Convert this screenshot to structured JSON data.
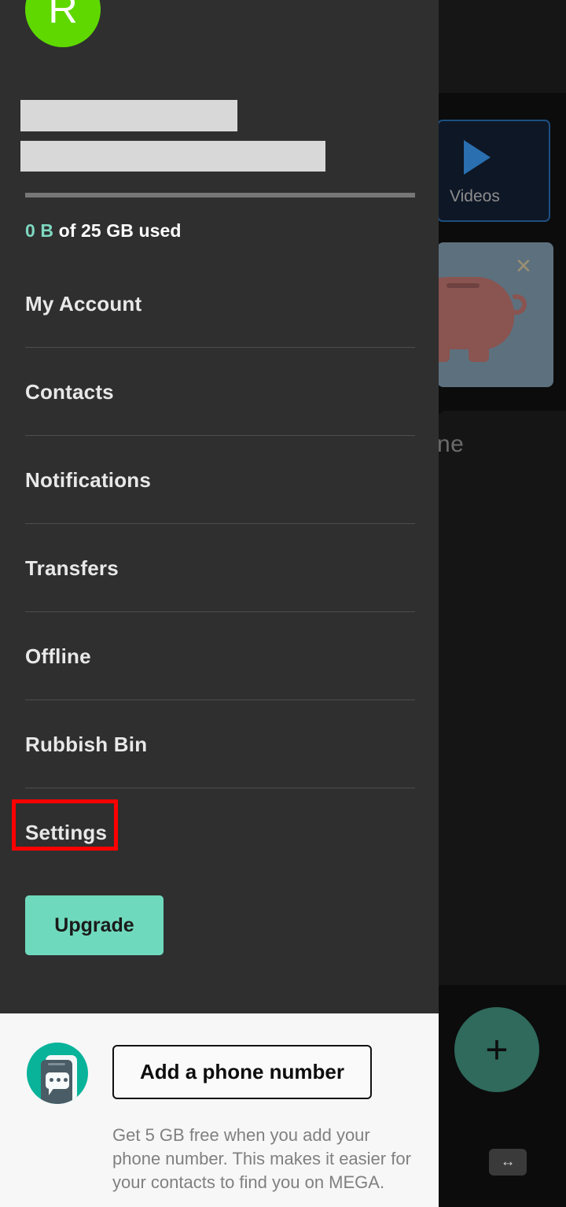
{
  "background_app": {
    "avatar": {
      "letter": "R",
      "status_dot": "online-dot"
    },
    "cards": [
      {
        "name": "videos-card",
        "label": "Videos",
        "icon": "play-icon",
        "border_color": "#1d4f80"
      },
      {
        "name": "piggy-bank-promo-card",
        "icon": "piggy-bank-icon",
        "close_icon": "×"
      }
    ],
    "sheet_title_partial": "ne",
    "fab": {
      "icon": "plus-icon",
      "label": "+",
      "color": "#2f6a5c"
    },
    "resize_handle": {
      "icon": "resize-horizontal-icon",
      "label": "↔"
    }
  },
  "drawer": {
    "avatar": {
      "letter": "R",
      "background_color": "#5fd800",
      "status_dot_color": "#9ce86a"
    },
    "redacted_fields": [
      {
        "name": "account-name-redacted"
      },
      {
        "name": "account-email-redacted"
      }
    ],
    "storage": {
      "used": "0 B",
      "rest": " of 25 GB used",
      "used_color": "#7fd8c0",
      "progress_percent": 0
    },
    "menu_items": [
      {
        "label": "My Account",
        "name": "sidebar-item-my-account"
      },
      {
        "label": "Contacts",
        "name": "sidebar-item-contacts"
      },
      {
        "label": "Notifications",
        "name": "sidebar-item-notifications"
      },
      {
        "label": "Transfers",
        "name": "sidebar-item-transfers"
      },
      {
        "label": "Offline",
        "name": "sidebar-item-offline"
      },
      {
        "label": "Rubbish Bin",
        "name": "sidebar-item-rubbish-bin"
      },
      {
        "label": "Settings",
        "name": "sidebar-item-settings",
        "highlighted": true
      }
    ],
    "upgrade_button": {
      "label": "Upgrade",
      "color": "#6fd9bd"
    }
  },
  "bottom_panel": {
    "icon": "phone-message-icon",
    "button_label": "Add a phone number",
    "description": "Get 5 GB free when you add your phone number. This makes it easier for your contacts to find you on MEGA."
  },
  "highlight": {
    "color": "#ff0000",
    "target": "Settings"
  }
}
